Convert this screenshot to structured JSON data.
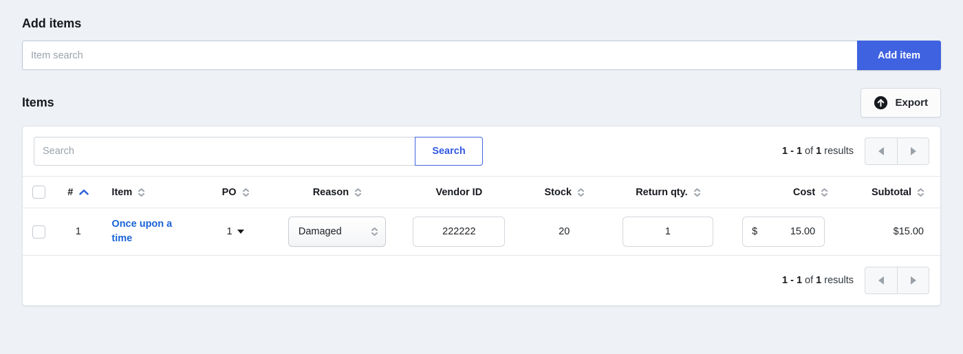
{
  "add_items": {
    "title": "Add items",
    "search_placeholder": "Item search",
    "search_value": "",
    "add_button": "Add item"
  },
  "items": {
    "title": "Items",
    "export_button": "Export",
    "search_placeholder": "Search",
    "search_value": "",
    "search_button": "Search",
    "pagination": {
      "range": "1 - 1",
      "of_label": "of",
      "total": "1",
      "results_label": "results",
      "prev_label": "◀",
      "next_label": "▶"
    },
    "columns": [
      {
        "label": "#",
        "sort": "asc"
      },
      {
        "label": "Item",
        "sort": "both"
      },
      {
        "label": "PO",
        "sort": "both"
      },
      {
        "label": "Reason",
        "sort": "both"
      },
      {
        "label": "Vendor ID",
        "sort": "none"
      },
      {
        "label": "Stock",
        "sort": "both"
      },
      {
        "label": "Return qty.",
        "sort": "both"
      },
      {
        "label": "Cost",
        "sort": "both"
      },
      {
        "label": "Subtotal",
        "sort": "both"
      }
    ],
    "rows": [
      {
        "num": "1",
        "item": "Once upon a time",
        "po": "1",
        "reason": "Damaged",
        "vendor_id": "222222",
        "stock": "20",
        "return_qty": "1",
        "cost_symbol": "$",
        "cost": "15.00",
        "subtotal": "$15.00"
      }
    ]
  },
  "colors": {
    "primary_blue": "#3f62e0",
    "link_blue": "#1a63d8",
    "page_bg": "#eef1f5",
    "card_bg": "#ffffff"
  }
}
